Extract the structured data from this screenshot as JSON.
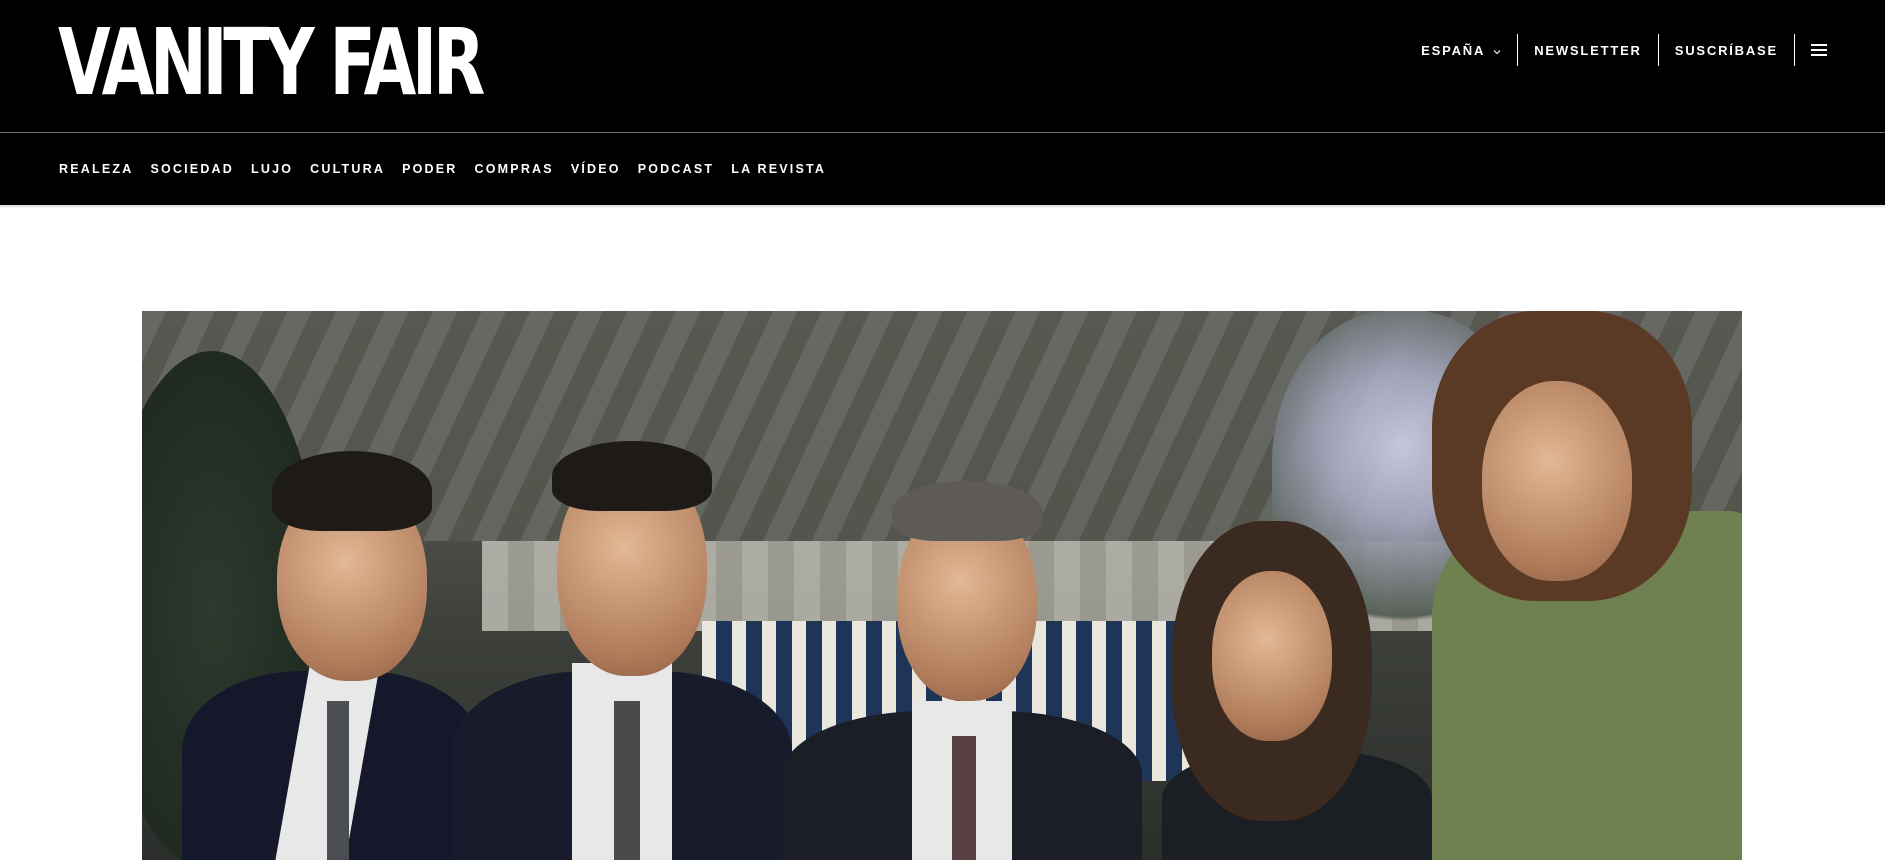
{
  "header": {
    "logo_text": "VANITY FAIR",
    "utility": {
      "edition_label": "ESPAÑA",
      "edition_chevron": "⌄",
      "newsletter_label": "NEWSLETTER",
      "subscribe_label": "SUSCRÍBASE",
      "menu_icon": "hamburger-menu-icon"
    }
  },
  "nav": {
    "items": [
      {
        "label": "REALEZA"
      },
      {
        "label": "SOCIEDAD"
      },
      {
        "label": "LUJO"
      },
      {
        "label": "CULTURA"
      },
      {
        "label": "PODER"
      },
      {
        "label": "COMPRAS"
      },
      {
        "label": "VÍDEO"
      },
      {
        "label": "PODCAST"
      },
      {
        "label": "LA REVISTA"
      }
    ]
  },
  "colors": {
    "header_bg": "#000000",
    "header_text": "#ffffff",
    "page_bg": "#ffffff"
  }
}
